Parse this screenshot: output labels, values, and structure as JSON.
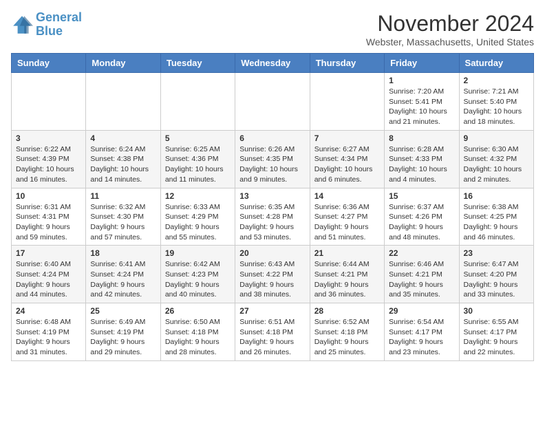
{
  "logo": {
    "line1": "General",
    "line2": "Blue"
  },
  "title": "November 2024",
  "location": "Webster, Massachusetts, United States",
  "days": [
    "Sunday",
    "Monday",
    "Tuesday",
    "Wednesday",
    "Thursday",
    "Friday",
    "Saturday"
  ],
  "weeks": [
    [
      {
        "day": "",
        "info": ""
      },
      {
        "day": "",
        "info": ""
      },
      {
        "day": "",
        "info": ""
      },
      {
        "day": "",
        "info": ""
      },
      {
        "day": "",
        "info": ""
      },
      {
        "day": "1",
        "info": "Sunrise: 7:20 AM\nSunset: 5:41 PM\nDaylight: 10 hours and 21 minutes."
      },
      {
        "day": "2",
        "info": "Sunrise: 7:21 AM\nSunset: 5:40 PM\nDaylight: 10 hours and 18 minutes."
      }
    ],
    [
      {
        "day": "3",
        "info": "Sunrise: 6:22 AM\nSunset: 4:39 PM\nDaylight: 10 hours and 16 minutes."
      },
      {
        "day": "4",
        "info": "Sunrise: 6:24 AM\nSunset: 4:38 PM\nDaylight: 10 hours and 14 minutes."
      },
      {
        "day": "5",
        "info": "Sunrise: 6:25 AM\nSunset: 4:36 PM\nDaylight: 10 hours and 11 minutes."
      },
      {
        "day": "6",
        "info": "Sunrise: 6:26 AM\nSunset: 4:35 PM\nDaylight: 10 hours and 9 minutes."
      },
      {
        "day": "7",
        "info": "Sunrise: 6:27 AM\nSunset: 4:34 PM\nDaylight: 10 hours and 6 minutes."
      },
      {
        "day": "8",
        "info": "Sunrise: 6:28 AM\nSunset: 4:33 PM\nDaylight: 10 hours and 4 minutes."
      },
      {
        "day": "9",
        "info": "Sunrise: 6:30 AM\nSunset: 4:32 PM\nDaylight: 10 hours and 2 minutes."
      }
    ],
    [
      {
        "day": "10",
        "info": "Sunrise: 6:31 AM\nSunset: 4:31 PM\nDaylight: 9 hours and 59 minutes."
      },
      {
        "day": "11",
        "info": "Sunrise: 6:32 AM\nSunset: 4:30 PM\nDaylight: 9 hours and 57 minutes."
      },
      {
        "day": "12",
        "info": "Sunrise: 6:33 AM\nSunset: 4:29 PM\nDaylight: 9 hours and 55 minutes."
      },
      {
        "day": "13",
        "info": "Sunrise: 6:35 AM\nSunset: 4:28 PM\nDaylight: 9 hours and 53 minutes."
      },
      {
        "day": "14",
        "info": "Sunrise: 6:36 AM\nSunset: 4:27 PM\nDaylight: 9 hours and 51 minutes."
      },
      {
        "day": "15",
        "info": "Sunrise: 6:37 AM\nSunset: 4:26 PM\nDaylight: 9 hours and 48 minutes."
      },
      {
        "day": "16",
        "info": "Sunrise: 6:38 AM\nSunset: 4:25 PM\nDaylight: 9 hours and 46 minutes."
      }
    ],
    [
      {
        "day": "17",
        "info": "Sunrise: 6:40 AM\nSunset: 4:24 PM\nDaylight: 9 hours and 44 minutes."
      },
      {
        "day": "18",
        "info": "Sunrise: 6:41 AM\nSunset: 4:24 PM\nDaylight: 9 hours and 42 minutes."
      },
      {
        "day": "19",
        "info": "Sunrise: 6:42 AM\nSunset: 4:23 PM\nDaylight: 9 hours and 40 minutes."
      },
      {
        "day": "20",
        "info": "Sunrise: 6:43 AM\nSunset: 4:22 PM\nDaylight: 9 hours and 38 minutes."
      },
      {
        "day": "21",
        "info": "Sunrise: 6:44 AM\nSunset: 4:21 PM\nDaylight: 9 hours and 36 minutes."
      },
      {
        "day": "22",
        "info": "Sunrise: 6:46 AM\nSunset: 4:21 PM\nDaylight: 9 hours and 35 minutes."
      },
      {
        "day": "23",
        "info": "Sunrise: 6:47 AM\nSunset: 4:20 PM\nDaylight: 9 hours and 33 minutes."
      }
    ],
    [
      {
        "day": "24",
        "info": "Sunrise: 6:48 AM\nSunset: 4:19 PM\nDaylight: 9 hours and 31 minutes."
      },
      {
        "day": "25",
        "info": "Sunrise: 6:49 AM\nSunset: 4:19 PM\nDaylight: 9 hours and 29 minutes."
      },
      {
        "day": "26",
        "info": "Sunrise: 6:50 AM\nSunset: 4:18 PM\nDaylight: 9 hours and 28 minutes."
      },
      {
        "day": "27",
        "info": "Sunrise: 6:51 AM\nSunset: 4:18 PM\nDaylight: 9 hours and 26 minutes."
      },
      {
        "day": "28",
        "info": "Sunrise: 6:52 AM\nSunset: 4:18 PM\nDaylight: 9 hours and 25 minutes."
      },
      {
        "day": "29",
        "info": "Sunrise: 6:54 AM\nSunset: 4:17 PM\nDaylight: 9 hours and 23 minutes."
      },
      {
        "day": "30",
        "info": "Sunrise: 6:55 AM\nSunset: 4:17 PM\nDaylight: 9 hours and 22 minutes."
      }
    ]
  ]
}
